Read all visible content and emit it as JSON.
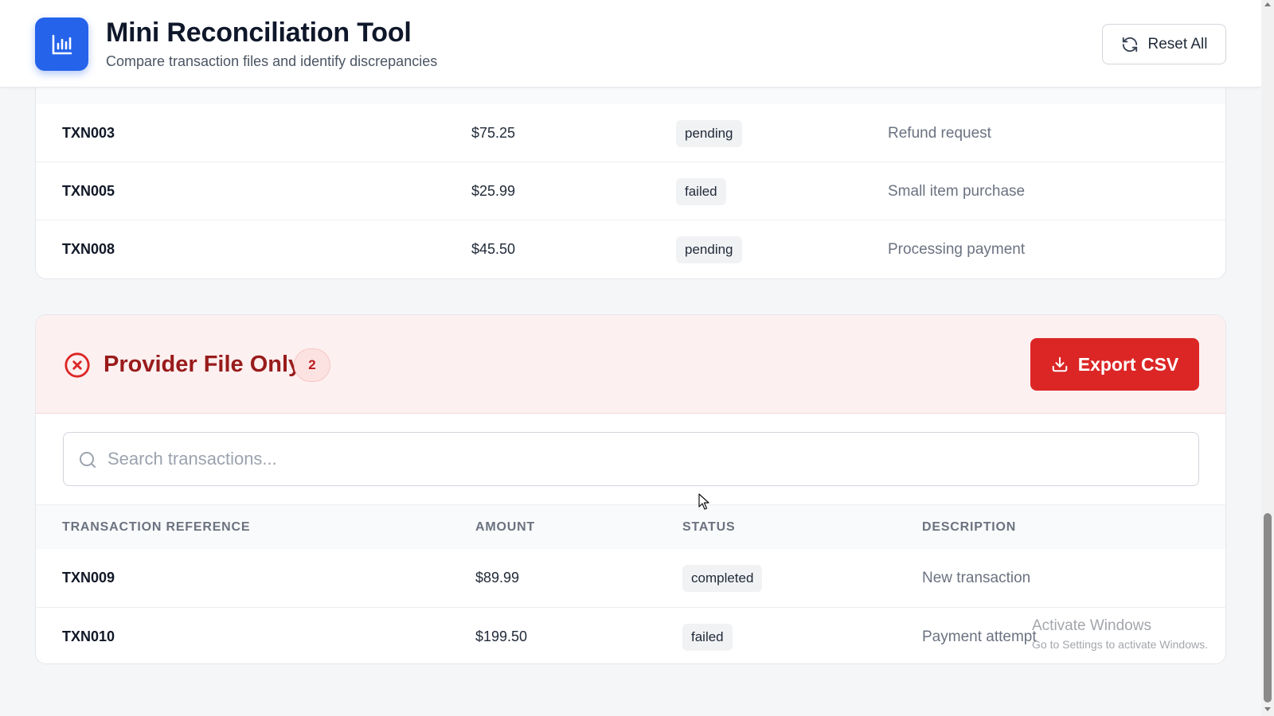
{
  "header": {
    "title": "Mini Reconciliation Tool",
    "subtitle": "Compare transaction files and identify discrepancies",
    "reset_label": "Reset All",
    "logo_icon": "bar-chart-icon",
    "logo_color": "#2563eb"
  },
  "top_section": {
    "rows": [
      {
        "ref": "TXN003",
        "amount": "$75.25",
        "status": "pending",
        "description": "Refund request"
      },
      {
        "ref": "TXN005",
        "amount": "$25.99",
        "status": "failed",
        "description": "Small item purchase"
      },
      {
        "ref": "TXN008",
        "amount": "$45.50",
        "status": "pending",
        "description": "Processing payment"
      }
    ]
  },
  "provider_section": {
    "title": "Provider File Only",
    "count": "2",
    "export_label": "Export CSV",
    "accent_color": "#dc2626",
    "search": {
      "placeholder": "Search transactions...",
      "value": ""
    },
    "columns": [
      "TRANSACTION REFERENCE",
      "AMOUNT",
      "STATUS",
      "DESCRIPTION"
    ],
    "rows": [
      {
        "ref": "TXN009",
        "amount": "$89.99",
        "status": "completed",
        "description": "New transaction"
      },
      {
        "ref": "TXN010",
        "amount": "$199.50",
        "status": "failed",
        "description": "Payment attempt"
      }
    ]
  },
  "watermark": {
    "line1": "Activate Windows",
    "line2": "Go to Settings to activate Windows."
  }
}
